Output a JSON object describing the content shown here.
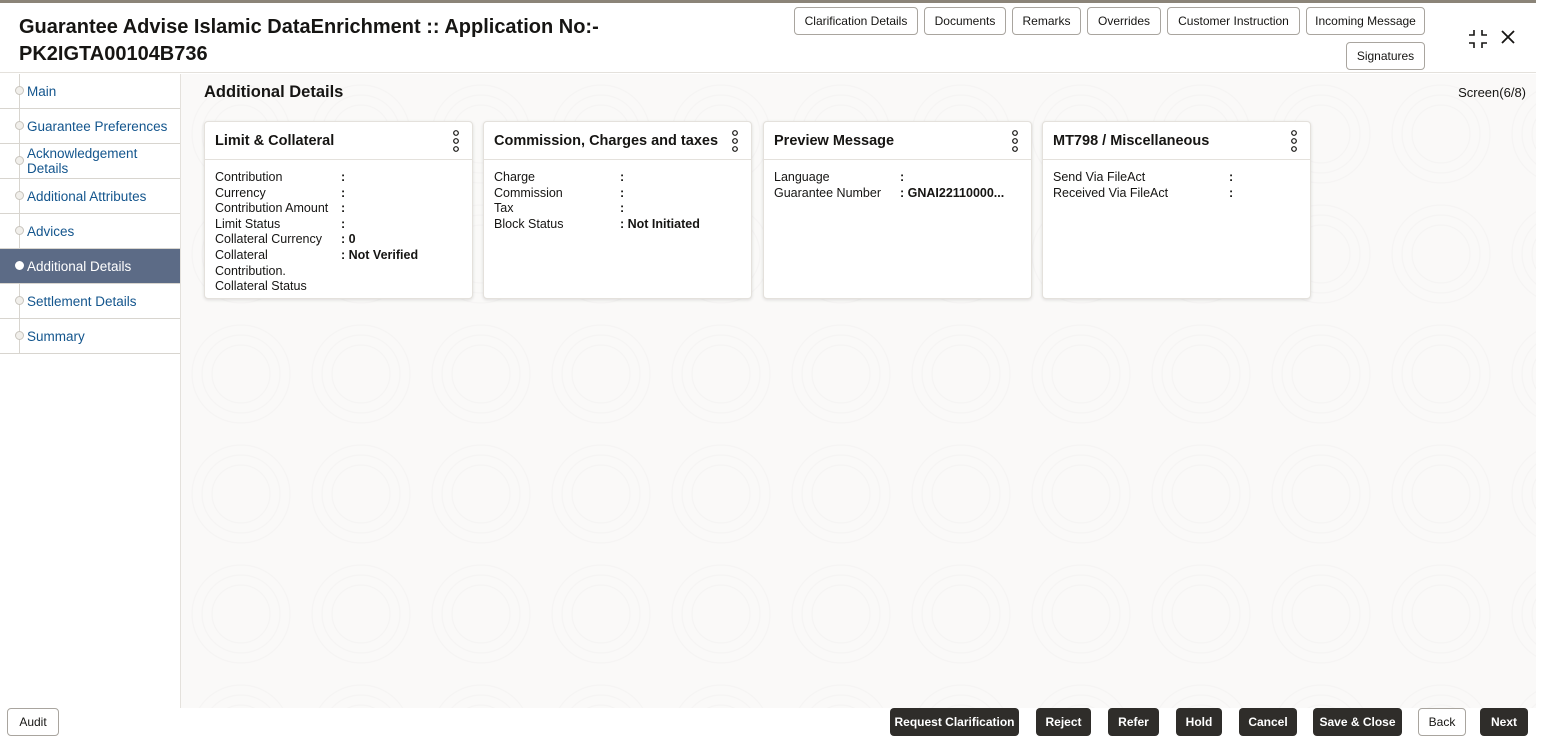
{
  "header": {
    "title_line1": "Guarantee Advise Islamic DataEnrichment :: Application No:-",
    "title_line2": "PK2IGTA00104B736",
    "buttons": {
      "clarification_details": "Clarification Details",
      "documents": "Documents",
      "remarks": "Remarks",
      "overrides": "Overrides",
      "customer_instruction": "Customer Instruction",
      "incoming_message": "Incoming Message",
      "signatures": "Signatures"
    }
  },
  "sidebar": {
    "items": [
      {
        "label": "Main"
      },
      {
        "label": "Guarantee Preferences"
      },
      {
        "label": "Acknowledgement Details"
      },
      {
        "label": "Additional Attributes"
      },
      {
        "label": "Advices"
      },
      {
        "label": "Additional Details",
        "active": true
      },
      {
        "label": "Settlement Details"
      },
      {
        "label": "Summary"
      }
    ]
  },
  "main": {
    "section_title": "Additional Details",
    "screen_count": "Screen(6/8)",
    "cards": [
      {
        "title": "Limit & Collateral",
        "rows": [
          {
            "label": "Contribution",
            "value": ":"
          },
          {
            "label": "Currency",
            "value": ":"
          },
          {
            "label": "Contribution Amount",
            "value": ":"
          },
          {
            "label": "Limit Status",
            "value": ":"
          },
          {
            "label": "Collateral Currency",
            "value": ": 0"
          },
          {
            "label": "Collateral",
            "value": ": Not Verified"
          },
          {
            "label": "Contribution.",
            "value": ""
          },
          {
            "label": "Collateral Status",
            "value": ""
          }
        ]
      },
      {
        "title": "Commission, Charges and taxes",
        "rows": [
          {
            "label": "Charge",
            "value": ":"
          },
          {
            "label": "Commission",
            "value": ":"
          },
          {
            "label": "Tax",
            "value": ":"
          },
          {
            "label": "Block Status",
            "value": ": Not Initiated"
          }
        ]
      },
      {
        "title": "Preview Message",
        "rows": [
          {
            "label": "Language",
            "value": ":"
          },
          {
            "label": "Guarantee Number",
            "value": ": GNAI22110000..."
          }
        ]
      },
      {
        "title": "MT798 / Miscellaneous",
        "rows": [
          {
            "label": "Send Via FileAct",
            "value": ":"
          },
          {
            "label": "Received Via FileAct",
            "value": ":"
          }
        ]
      }
    ]
  },
  "footer": {
    "audit": "Audit",
    "request_clarification": "Request Clarification",
    "reject": "Reject",
    "refer": "Refer",
    "hold": "Hold",
    "cancel": "Cancel",
    "save_close": "Save & Close",
    "back": "Back",
    "next": "Next"
  },
  "colors": {
    "sidebar_active": "#5c6b86",
    "link_blue": "#13558d",
    "dark_button": "#2f2d2a"
  }
}
